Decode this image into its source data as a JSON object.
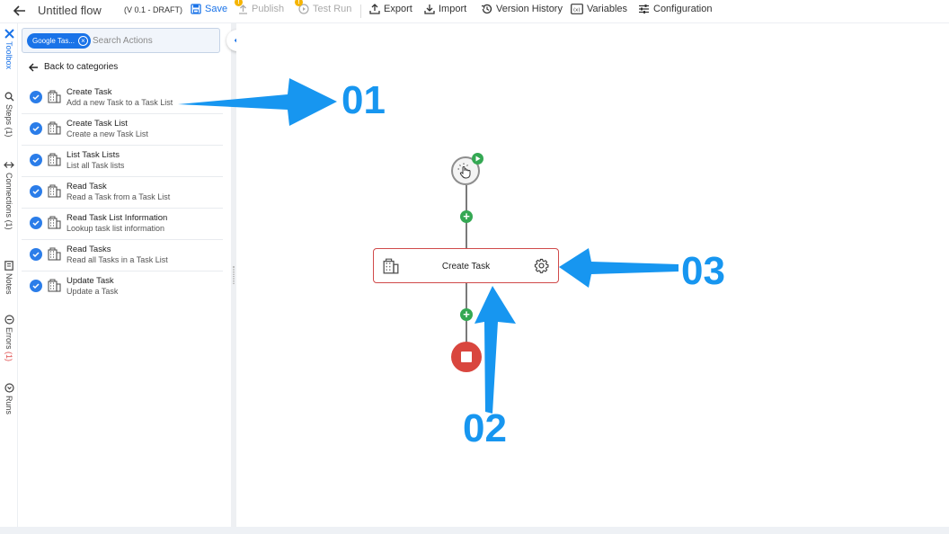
{
  "topbar": {
    "title": "Untitled flow",
    "version": "(V 0.1 - DRAFT)",
    "save": "Save",
    "publish": "Publish",
    "test_run": "Test Run",
    "export": "Export",
    "import": "Import",
    "version_history": "Version History",
    "variables": "Variables",
    "configuration": "Configuration",
    "warning_badge": "!"
  },
  "rail": {
    "toolbox": "Toolbox",
    "steps": "Steps",
    "steps_count": "(1)",
    "connections": "Connections",
    "connections_count": "(1)",
    "notes": "Notes",
    "errors": "Errors",
    "errors_count": "(1)",
    "runs": "Runs"
  },
  "panel": {
    "filter_chip": "Google Tas...",
    "search_placeholder": "Search Actions",
    "back_label": "Back to categories",
    "actions": [
      {
        "name": "Create Task",
        "desc": "Add a new Task to a Task List"
      },
      {
        "name": "Create Task List",
        "desc": "Create a new Task List"
      },
      {
        "name": "List Task Lists",
        "desc": "List all Task lists"
      },
      {
        "name": "Read Task",
        "desc": "Read a Task from a Task List"
      },
      {
        "name": "Read Task List Information",
        "desc": "Lookup task list information"
      },
      {
        "name": "Read Tasks",
        "desc": "Read all Tasks in a Task List"
      },
      {
        "name": "Update Task",
        "desc": "Update a Task"
      }
    ]
  },
  "canvas": {
    "step_title": "Create Task",
    "plus": "+"
  },
  "annotations": {
    "a1": "01",
    "a2": "02",
    "a3": "03"
  },
  "colors": {
    "accent": "#1a73e8",
    "annotation": "#1796f0",
    "add_node": "#34a853",
    "stop": "#d9463e",
    "error_border": "#d04a4a"
  }
}
